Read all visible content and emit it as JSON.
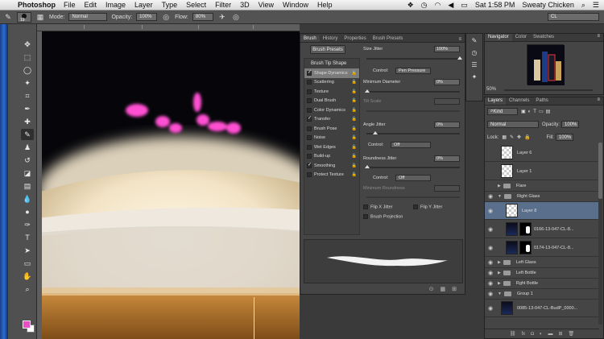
{
  "menubar": {
    "app": "Photoshop",
    "menus": [
      "File",
      "Edit",
      "Image",
      "Layer",
      "Type",
      "Select",
      "Filter",
      "3D",
      "View",
      "Window",
      "Help"
    ],
    "clock": "Sat 1:58 PM",
    "user": "Sweaty Chicken"
  },
  "options": {
    "brush_size": "19",
    "mode_label": "Mode:",
    "mode_value": "Normal",
    "opacity_label": "Opacity:",
    "opacity_value": "100%",
    "flow_label": "Flow:",
    "flow_value": "80%",
    "workspace": "CL"
  },
  "brush_panel": {
    "tabs": [
      "Brush",
      "History",
      "Properties",
      "Brush Presets"
    ],
    "presets_button": "Brush Presets",
    "list_header": "Brush Tip Shape",
    "items": [
      {
        "label": "Shape Dynamics",
        "checked": true,
        "selected": true
      },
      {
        "label": "Scattering",
        "checked": false
      },
      {
        "label": "Texture",
        "checked": false
      },
      {
        "label": "Dual Brush",
        "checked": false
      },
      {
        "label": "Color Dynamics",
        "checked": false
      },
      {
        "label": "Transfer",
        "checked": true
      },
      {
        "label": "Brush Pose",
        "checked": false
      },
      {
        "label": "Noise",
        "checked": false
      },
      {
        "label": "Wet Edges",
        "checked": false
      },
      {
        "label": "Build-up",
        "checked": false
      },
      {
        "label": "Smoothing",
        "checked": true
      },
      {
        "label": "Protect Texture",
        "checked": false
      }
    ],
    "size_jitter_label": "Size Jitter",
    "size_jitter_value": "100%",
    "size_jitter_fraction": 1.0,
    "control_label": "Control:",
    "control1": "Pen Pressure",
    "min_diameter_label": "Minimum Diameter",
    "min_diameter_value": "0%",
    "tilt_scale_label": "Tilt Scale",
    "angle_jitter_label": "Angle Jitter",
    "angle_jitter_value": "0%",
    "control2": "Off",
    "roundness_jitter_label": "Roundness Jitter",
    "roundness_jitter_value": "0%",
    "control3": "Off",
    "min_roundness_label": "Minimum Roundness",
    "flip_x": "Flip X Jitter",
    "flip_y": "Flip Y Jitter",
    "brush_projection": "Brush Projection"
  },
  "navigator": {
    "tabs": [
      "Navigator",
      "Color",
      "Swatches"
    ],
    "zoom": "50%"
  },
  "layers": {
    "tabs": [
      "Layers",
      "Channels",
      "Paths"
    ],
    "kind": "Kind",
    "blend": "Normal",
    "opacity_label": "Opacity:",
    "opacity_value": "100%",
    "lock_label": "Lock:",
    "fill_label": "Fill:",
    "fill_value": "100%",
    "items": [
      {
        "name": "Layer 6",
        "type": "layer",
        "visible": false
      },
      {
        "name": "Layer 1",
        "type": "layer",
        "visible": false
      },
      {
        "name": "Flare",
        "type": "group",
        "visible": false
      },
      {
        "name": "Right Glass",
        "type": "group",
        "visible": true,
        "open": true
      },
      {
        "name": "Layer 8",
        "type": "layer",
        "visible": true,
        "selected": true
      },
      {
        "name": "0166-13-047-CL-8...",
        "type": "masked",
        "visible": true
      },
      {
        "name": "0174-13-047-CL-8...",
        "type": "masked",
        "visible": true
      },
      {
        "name": "Left Glass",
        "type": "group",
        "visible": true
      },
      {
        "name": "Left Bottle",
        "type": "group",
        "visible": true
      },
      {
        "name": "Rght Bottle",
        "type": "group",
        "visible": true
      },
      {
        "name": "Group 1",
        "type": "group",
        "visible": true,
        "open": true
      },
      {
        "name": "0085-13-047-CL-BudP_0000...",
        "type": "image",
        "visible": true
      }
    ]
  },
  "colors": {
    "foreground": "#e84fc3",
    "background": "#ffffff",
    "selected_layer": "#5a6f8c"
  }
}
